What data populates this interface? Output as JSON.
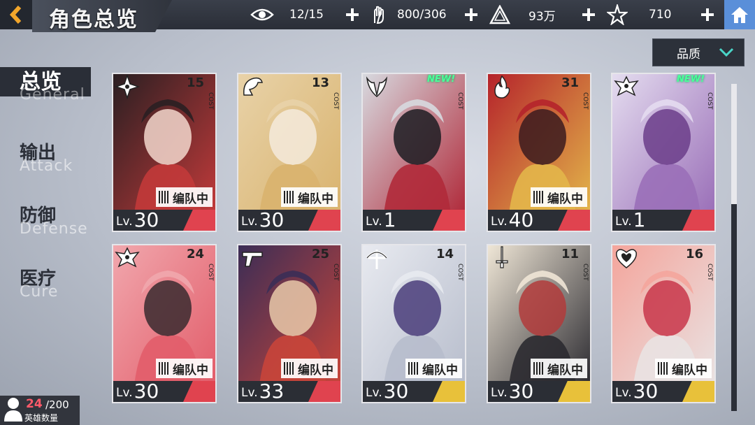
{
  "header": {
    "title": "角色总览",
    "resources": [
      {
        "icon": "eye-icon",
        "value": "12/15"
      },
      {
        "icon": "heart-hand-icon",
        "value": "800/306"
      },
      {
        "icon": "gold-pyramid-icon",
        "value": "93万"
      },
      {
        "icon": "star-crystal-icon",
        "value": "710"
      }
    ]
  },
  "filter": {
    "quality_label": "品质"
  },
  "sidebar": {
    "items": [
      {
        "cn": "总览",
        "en": "General",
        "active": true
      },
      {
        "cn": "输出",
        "en": "Attack",
        "active": false
      },
      {
        "cn": "防御",
        "en": "Defense",
        "active": false
      },
      {
        "cn": "医疗",
        "en": "Cure",
        "active": false
      }
    ]
  },
  "cards": [
    {
      "cost": "15",
      "level": "30",
      "class_icon": "shuriken-icon",
      "in_team": true,
      "new": false,
      "rarity_color": "#e0434f",
      "art": [
        "#2a1f22",
        "#c23a3a",
        "#f3d7cc"
      ]
    },
    {
      "cost": "13",
      "level": "30",
      "class_icon": "dragon-icon",
      "in_team": true,
      "new": false,
      "rarity_color": "#e0434f",
      "art": [
        "#e8d2a8",
        "#d9b36e",
        "#f5eadc"
      ]
    },
    {
      "cost": "",
      "level": "1",
      "class_icon": "horned-crest-icon",
      "in_team": false,
      "new": true,
      "rarity_color": "#e0434f",
      "art": [
        "#d7d9df",
        "#b02a3a",
        "#1c1c22"
      ]
    },
    {
      "cost": "31",
      "level": "40",
      "class_icon": "flame-icon",
      "in_team": true,
      "new": false,
      "rarity_color": "#e0434f",
      "art": [
        "#b5232b",
        "#e3b64a",
        "#3b1b1f"
      ]
    },
    {
      "cost": "",
      "level": "1",
      "class_icon": "winged-crest-icon",
      "in_team": false,
      "new": true,
      "rarity_color": "#e0434f",
      "art": [
        "#e4dcef",
        "#9a6fb8",
        "#6b3d8a"
      ]
    },
    {
      "cost": "24",
      "level": "30",
      "class_icon": "winged-crest-icon",
      "in_team": true,
      "new": false,
      "rarity_color": "#e0434f",
      "art": [
        "#f1a7ad",
        "#e25d6a",
        "#3a2a2f"
      ]
    },
    {
      "cost": "25",
      "level": "33",
      "class_icon": "pistol-icon",
      "in_team": true,
      "new": false,
      "rarity_color": "#e0434f",
      "art": [
        "#3b2d56",
        "#c8453a",
        "#e9c9a9"
      ]
    },
    {
      "cost": "14",
      "level": "30",
      "class_icon": "crossbow-icon",
      "in_team": true,
      "new": false,
      "rarity_color": "#e8c13a",
      "art": [
        "#e8eaf0",
        "#b7bdcc",
        "#4a3d7a"
      ]
    },
    {
      "cost": "11",
      "level": "30",
      "class_icon": "sword-icon",
      "in_team": true,
      "new": false,
      "rarity_color": "#e8c13a",
      "art": [
        "#efe6d6",
        "#2b2a30",
        "#b13b3b"
      ]
    },
    {
      "cost": "16",
      "level": "30",
      "class_icon": "heart-icon",
      "in_team": true,
      "new": false,
      "rarity_color": "#e8c13a",
      "art": [
        "#f4a59c",
        "#e9e2e2",
        "#c8364a"
      ]
    }
  ],
  "labels": {
    "in_team": "编队中",
    "cost": "COST",
    "lv_prefix": "Lv.",
    "new": "NEW!"
  },
  "hero_count": {
    "current": "24",
    "max": "/200",
    "label": "英雄数量"
  }
}
